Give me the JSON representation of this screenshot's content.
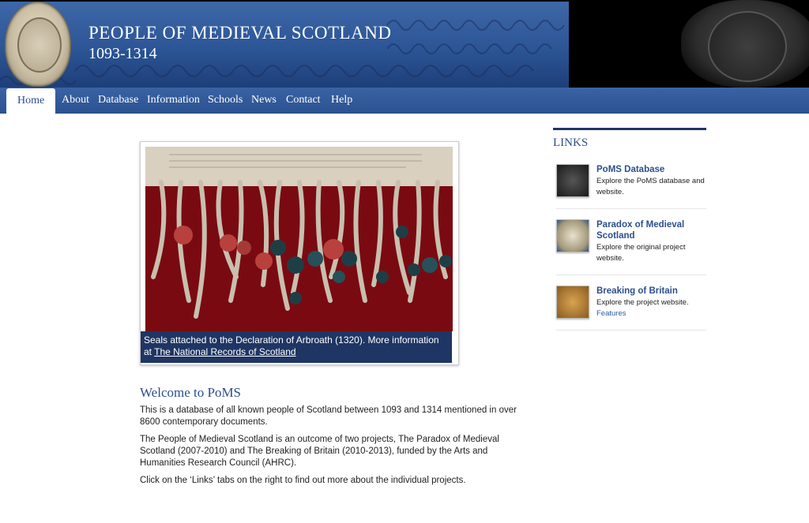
{
  "site": {
    "title": "PEOPLE OF MEDIEVAL SCOTLAND",
    "dates": "1093-1314"
  },
  "nav": {
    "items": [
      "Home",
      "About",
      "Database",
      "Information",
      "Schools",
      "News",
      "Contact",
      "Help"
    ],
    "active": "Home"
  },
  "feature": {
    "caption_text": "Seals attached to the Declaration of Arbroath (1320). More information at ",
    "caption_link": "The National Records of Scotland"
  },
  "welcome": {
    "title": "Welcome to PoMS",
    "p1": "This is a database of all known people of Scotland between 1093 and 1314 mentioned in over 8600 contemporary documents.",
    "p2": "The People of Medieval Scotland is an outcome of two projects, The Paradox of Medieval Scotland (2007-2010) and The Breaking of Britain (2010-2013), funded by the Arts and Humanities Research Council (AHRC).",
    "p3": "Click on the ‘Links’ tabs on the right to find out more about the individual projects."
  },
  "links": {
    "title": "LINKS",
    "items": [
      {
        "title": "PoMS Database",
        "desc": "Explore the PoMS database and website.",
        "extra": ""
      },
      {
        "title": "Paradox of Medieval Scotland",
        "desc": "Explore the original project website.",
        "extra": ""
      },
      {
        "title": "Breaking of Britain",
        "desc": "Explore the project website.",
        "extra": "Features"
      }
    ]
  },
  "colors": {
    "banner_blue": "#2c5596",
    "nav_blue": "#2b5190",
    "heading_blue": "#2c4f8c",
    "caption_bg": "#1f3564",
    "photo_red": "#7a0a12"
  }
}
